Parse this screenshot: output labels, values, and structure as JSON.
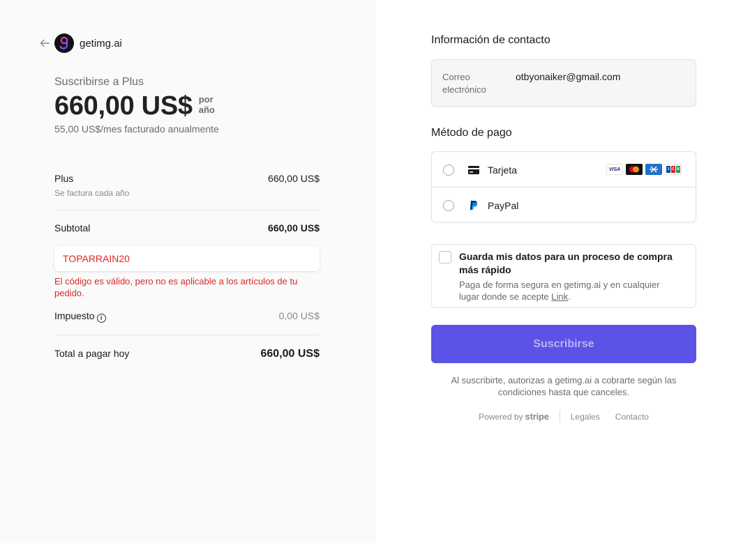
{
  "brand": {
    "name": "getimg.ai"
  },
  "summary": {
    "subscribe_label": "Suscribirse a Plus",
    "price": "660,00 US$",
    "per_line1": "por",
    "per_line2": "año",
    "monthly": "55,00 US$/mes facturado anualmente"
  },
  "items": {
    "plan_name": "Plus",
    "plan_price": "660,00 US$",
    "plan_note": "Se factura cada año",
    "subtotal_label": "Subtotal",
    "subtotal_value": "660,00 US$",
    "promo_code": "TOPARRAIN20",
    "promo_error": "El código es válido, pero no es aplicable a los artículos de tu pedido.",
    "tax_label": "Impuesto",
    "tax_value": "0,00 US$",
    "total_label": "Total a pagar hoy",
    "total_value": "660,00 US$"
  },
  "contact": {
    "title": "Información de contacto",
    "email_label": "Correo electrónico",
    "email_value": "otbyonaiker@gmail.com"
  },
  "payment": {
    "title": "Método de pago",
    "options": [
      {
        "label": "Tarjeta",
        "icon": "credit-card-icon"
      },
      {
        "label": "PayPal",
        "icon": "paypal-icon"
      }
    ],
    "card_brands": [
      "VISA",
      "MC",
      "AMEX",
      "JCB"
    ]
  },
  "save": {
    "title": "Guarda mis datos para un proceso de compra más rápido",
    "desc_prefix": "Paga de forma segura en getimg.ai y en cualquier lugar donde se acepte ",
    "link": "Link",
    "desc_suffix": "."
  },
  "cta": {
    "subscribe": "Suscribirse"
  },
  "terms": "Al suscribirte, autorizas a getimg.ai a cobrarte según las condiciones hasta que canceles.",
  "footer": {
    "powered_by": "Powered by",
    "stripe": "stripe",
    "legal": "Legales",
    "contact": "Contacto"
  },
  "colors": {
    "accent": "#5b53e6",
    "error": "#dc2727"
  }
}
